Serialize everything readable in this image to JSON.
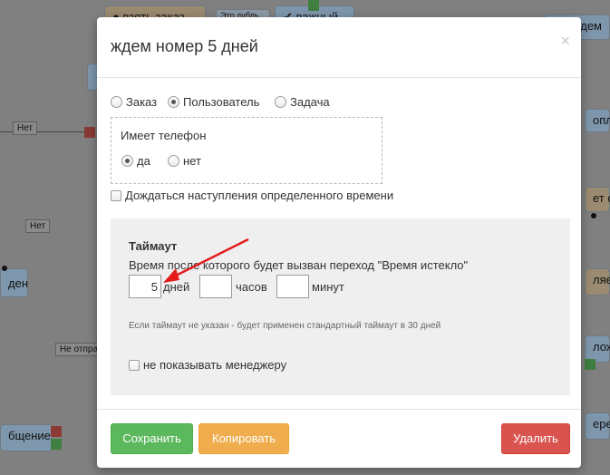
{
  "background": {
    "nodes": {
      "take_order": "взять заказ",
      "duplicate": "Это дубль",
      "important": "важный",
      "dem": "дем",
      "den": "ден",
      "message": "бщение",
      "payment": "оплач",
      "operator": "ет опе",
      "sent_to": "ляем",
      "location": "ложе",
      "transfer": "ерез"
    },
    "labels": {
      "net1": "Нет",
      "net2": "Нет",
      "not_sent": "Не отправ"
    }
  },
  "modal": {
    "title": "ждем номер 5 дней",
    "close": "×",
    "entity_options": [
      {
        "label": "Заказ",
        "checked": false
      },
      {
        "label": "Пользователь",
        "checked": true
      },
      {
        "label": "Задача",
        "checked": false
      }
    ],
    "phone_group": {
      "title": "Имеет телефон",
      "options": [
        {
          "label": "да",
          "checked": true
        },
        {
          "label": "нет",
          "checked": false
        }
      ]
    },
    "wait_time_label": "Дождаться наступления определенного времени",
    "timeout": {
      "title": "Таймаут",
      "description": "Время после которого будет вызван переход \"Время истекло\"",
      "days_value": "5",
      "days_label": "дней",
      "hours_value": "",
      "hours_label": "часов",
      "minutes_value": "",
      "minutes_label": "минут",
      "hint": "Если таймаут не указан - будет применен стандартный таймаут в 30 дней",
      "hide_manager_label": "не показывать менеджеру"
    },
    "buttons": {
      "save": "Сохранить",
      "copy": "Копировать",
      "delete": "Удалить"
    }
  },
  "colors": {
    "save": "#5cb85c",
    "copy": "#f0ad4e",
    "delete": "#d9534f",
    "annotation_arrow": "#e31b1b"
  }
}
